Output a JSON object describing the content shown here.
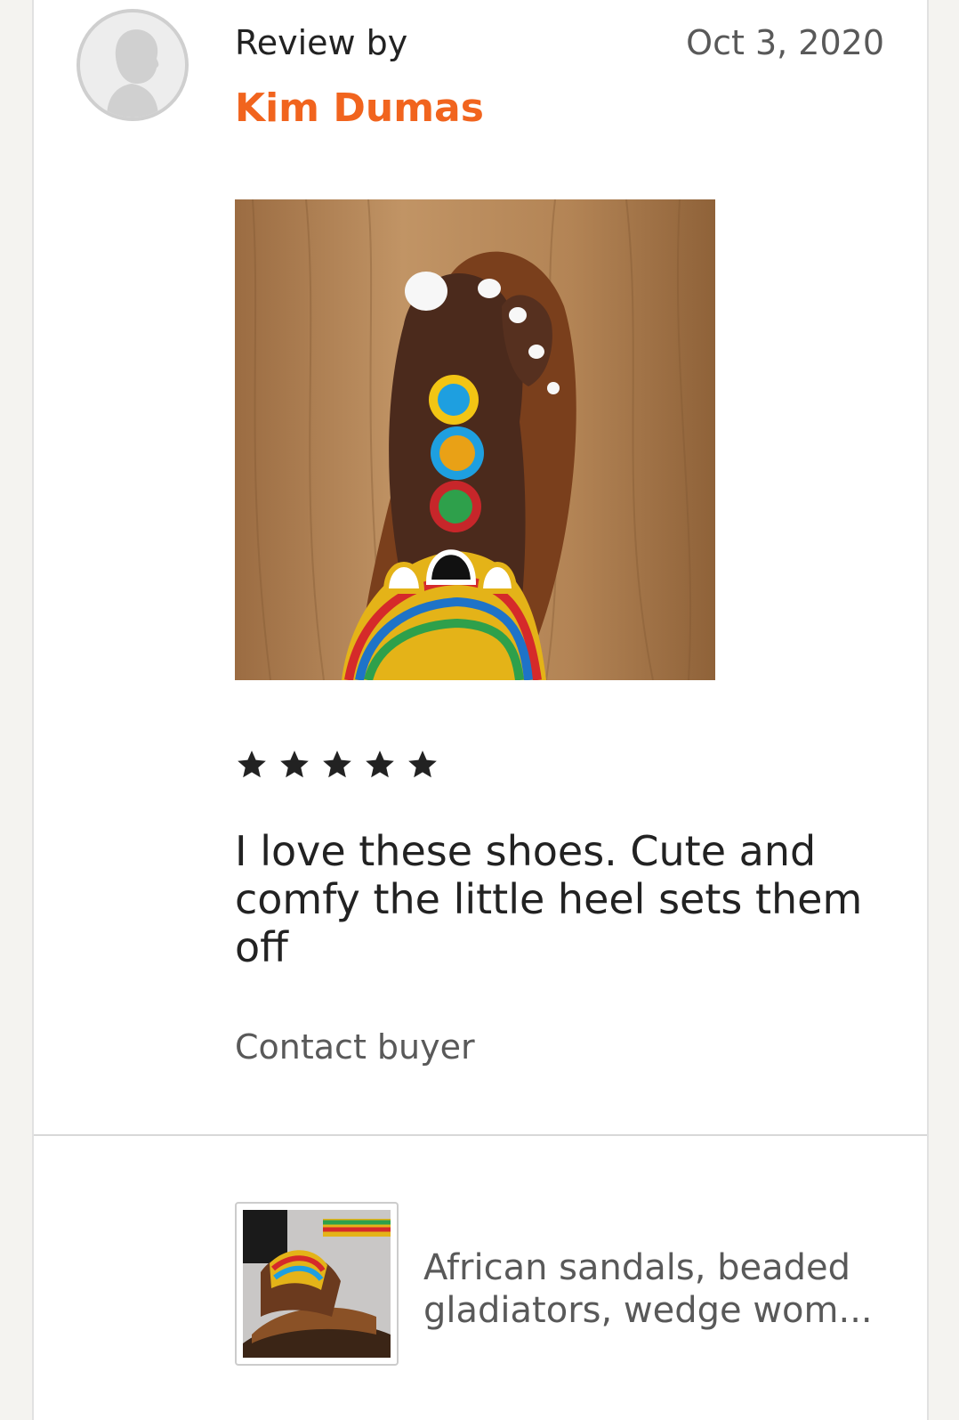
{
  "review": {
    "label": "Review by",
    "reviewer_name": "Kim Dumas",
    "date": "Oct 3, 2020",
    "rating": 5,
    "rating_max": 5,
    "text": "I love these shoes. Cute and comfy the little heel sets them off",
    "contact_label": "Contact buyer"
  },
  "product": {
    "title": "African sandals, beaded gladiators, wedge wom..."
  },
  "colors": {
    "accent": "#f1641e",
    "text": "#222222",
    "muted": "#595959",
    "divider": "#d8d8d8"
  },
  "icons": {
    "avatar": "default-avatar-icon",
    "star": "star-icon"
  }
}
